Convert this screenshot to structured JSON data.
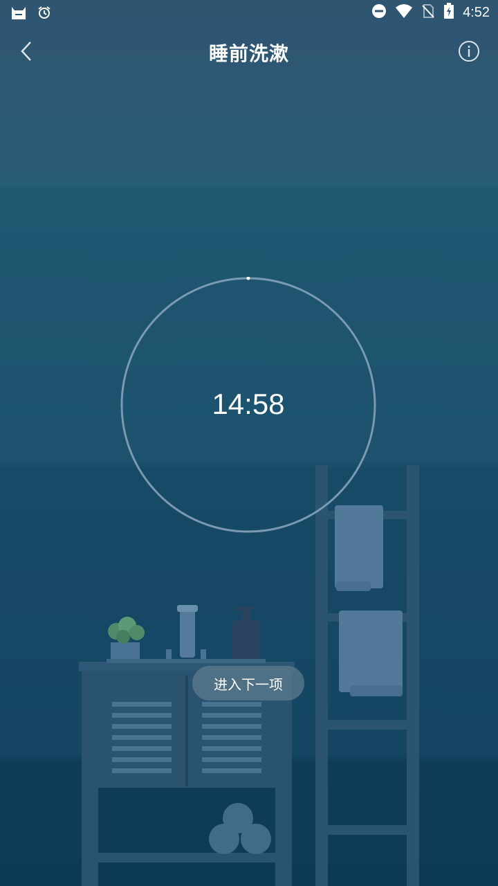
{
  "status_bar": {
    "time": "4:52"
  },
  "header": {
    "title": "睡前洗漱"
  },
  "timer": {
    "time": "14:58",
    "progress": 0.0
  },
  "actions": {
    "next_label": "进入下一项"
  },
  "colors": {
    "ring": "#7a9ab3",
    "accent": "#ffffff"
  }
}
